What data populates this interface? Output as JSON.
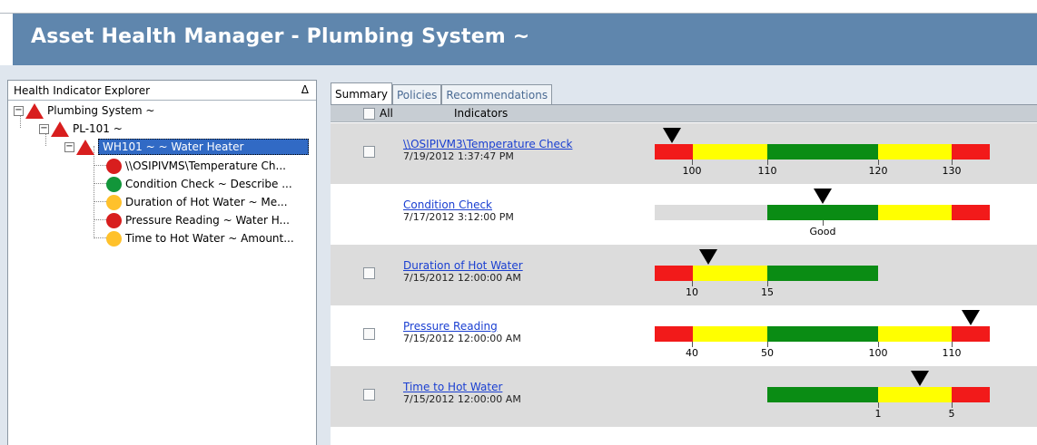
{
  "header": {
    "title": "Asset Health Manager - Plumbing System ~"
  },
  "tree": {
    "title": "Health Indicator Explorer",
    "sort_glyph": "Δ",
    "nodes": [
      {
        "label": "Plumbing System ~",
        "icon": "red-triangle",
        "expander": "−"
      },
      {
        "label": "PL-101 ~",
        "icon": "red-triangle",
        "expander": "−"
      },
      {
        "label": "WH101 ~  ~ Water Heater",
        "icon": "red-triangle",
        "expander": "−",
        "selected": true
      },
      {
        "label": "\\\\OSIPIVMS\\Temperature Ch...",
        "icon": "red-dot"
      },
      {
        "label": "Condition Check ~ Describe ...",
        "icon": "green-dot"
      },
      {
        "label": "Duration of Hot Water ~ Me...",
        "icon": "yellow-dot"
      },
      {
        "label": "Pressure Reading ~ Water H...",
        "icon": "red-dot"
      },
      {
        "label": "Time to Hot Water ~ Amount...",
        "icon": "yellow-dot"
      }
    ]
  },
  "tabs": [
    {
      "label": "Summary",
      "active": true
    },
    {
      "label": "Policies",
      "active": false
    },
    {
      "label": "Recommendations",
      "active": false
    }
  ],
  "columns": {
    "all": "All",
    "indicators": "Indicators"
  },
  "colors": {
    "red": "#f21a1a",
    "yellow": "#ffff00",
    "green": "#0a8c14",
    "grey": "#dcdcdc",
    "header": "#5f86ad"
  },
  "indicators": [
    {
      "name": "\\\\OSIPIVM3\\Temperature Check",
      "date": "7/19/2012 1:37:47 PM",
      "checkbox": true,
      "ticks": [
        "100",
        "110",
        "120",
        "130"
      ]
    },
    {
      "name": "Condition Check",
      "date": "7/17/2012 3:12:00 PM",
      "checkbox": false,
      "ticks": [
        "Good"
      ]
    },
    {
      "name": "Duration of Hot Water",
      "date": "7/15/2012 12:00:00 AM",
      "checkbox": true,
      "ticks": [
        "10",
        "15"
      ]
    },
    {
      "name": "Pressure Reading",
      "date": "7/15/2012 12:00:00 AM",
      "checkbox": true,
      "ticks": [
        "40",
        "50",
        "100",
        "110"
      ]
    },
    {
      "name": "Time to Hot Water",
      "date": "7/15/2012 12:00:00 AM",
      "checkbox": true,
      "ticks": [
        "1",
        "5"
      ]
    }
  ]
}
